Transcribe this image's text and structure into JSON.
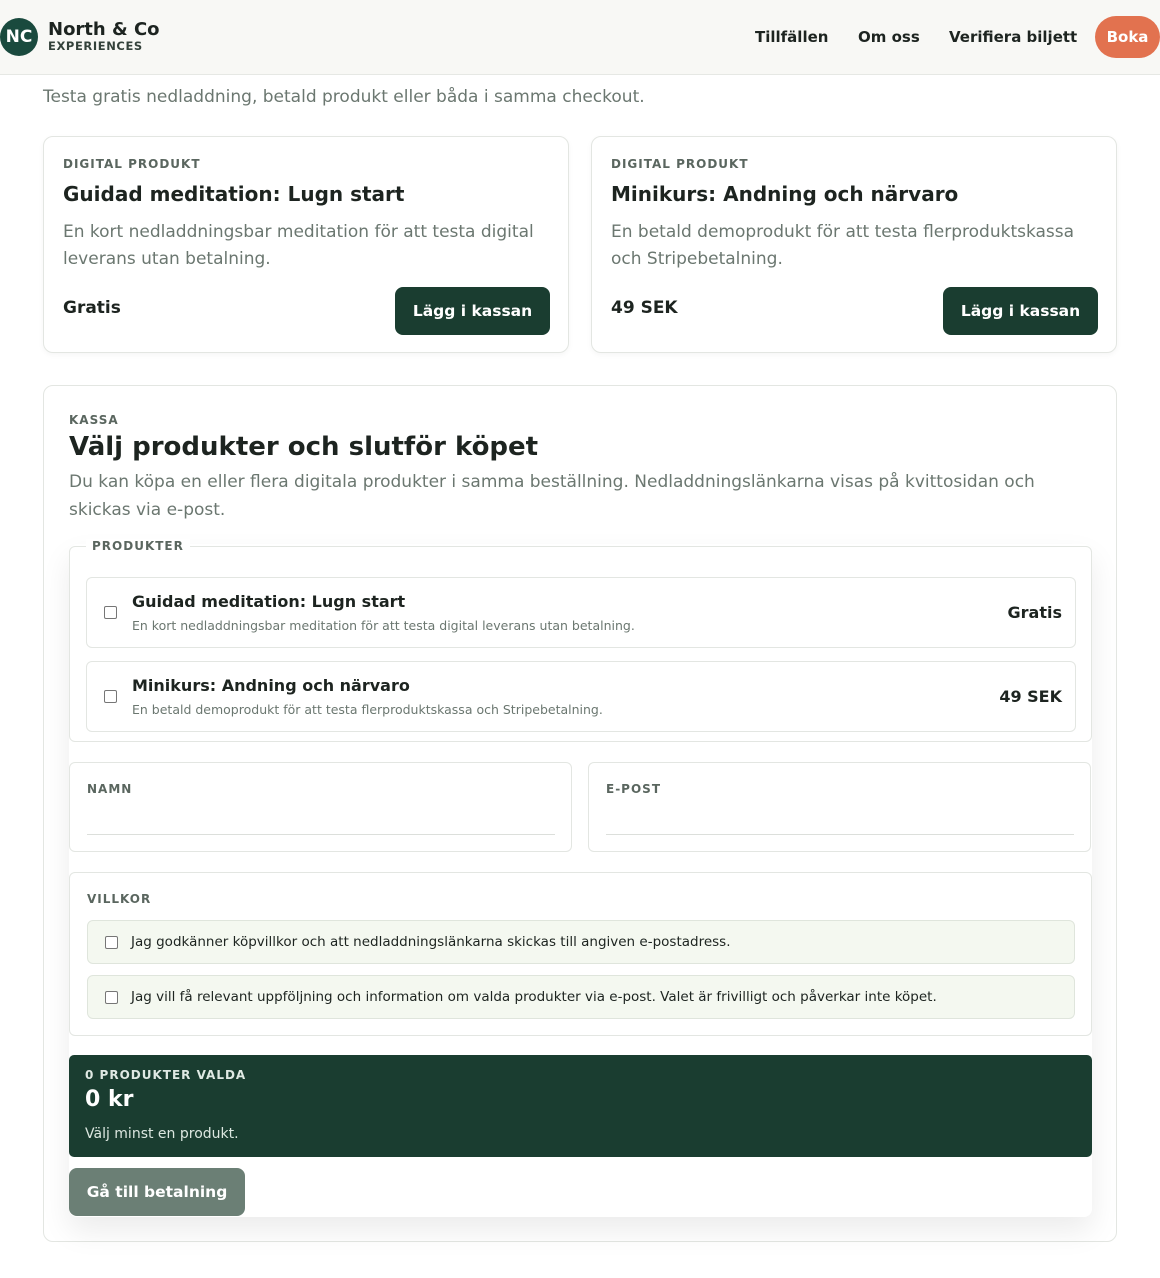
{
  "header": {
    "logo_initials": "NC",
    "brand_name": "North & Co",
    "brand_sub": "EXPERIENCES",
    "nav": [
      "Tillfällen",
      "Om oss",
      "Verifiera biljett"
    ],
    "cta": "Boka"
  },
  "intro": "Testa gratis nedladdning, betald produkt eller båda i samma checkout.",
  "products": [
    {
      "eyebrow": "DIGITAL PRODUKT",
      "title": "Guidad meditation: Lugn start",
      "description": "En kort nedladdningsbar meditation för att testa digital leverans utan betalning.",
      "price": "Gratis",
      "button": "Lägg i kassan"
    },
    {
      "eyebrow": "DIGITAL PRODUKT",
      "title": "Minikurs: Andning och närvaro",
      "description": "En betald demoprodukt för att testa flerproduktskassa och Stripebetalning.",
      "price": "49 SEK",
      "button": "Lägg i kassan"
    }
  ],
  "checkout": {
    "eyebrow": "KASSA",
    "title": "Välj produkter och slutför köpet",
    "description": "Du kan köpa en eller flera digitala produkter i samma beställning. Nedladdningslänkarna visas på kvittosidan och skickas via e-post.",
    "products_legend": "PRODUKTER",
    "items": [
      {
        "name": "Guidad meditation: Lugn start",
        "description": "En kort nedladdningsbar meditation för att testa digital leverans utan betalning.",
        "price": "Gratis",
        "checked": false
      },
      {
        "name": "Minikurs: Andning och närvaro",
        "description": "En betald demoprodukt för att testa flerproduktskassa och Stripebetalning.",
        "price": "49 SEK",
        "checked": false
      }
    ],
    "name_label": "NAMN",
    "name_value": "",
    "email_label": "E-POST",
    "email_value": "",
    "terms_label": "VILLKOR",
    "terms": [
      {
        "text": "Jag godkänner köpvillkor och att nedladdningslänkarna skickas till angiven e-postadress.",
        "checked": false
      },
      {
        "text": "Jag vill få relevant uppföljning och information om valda produkter via e-post. Valet är frivilligt och påverkar inte köpet.",
        "checked": false
      }
    ],
    "summary": {
      "count": "0 PRODUKTER VALDA",
      "total": "0 kr",
      "hint": "Välj minst en produkt."
    },
    "pay_button": "Gå till betalning"
  },
  "colors": {
    "brand_dark": "#1a3d30",
    "accent": "#e2724f",
    "muted_text": "#6b7770",
    "disabled_button": "#6b7f75"
  }
}
